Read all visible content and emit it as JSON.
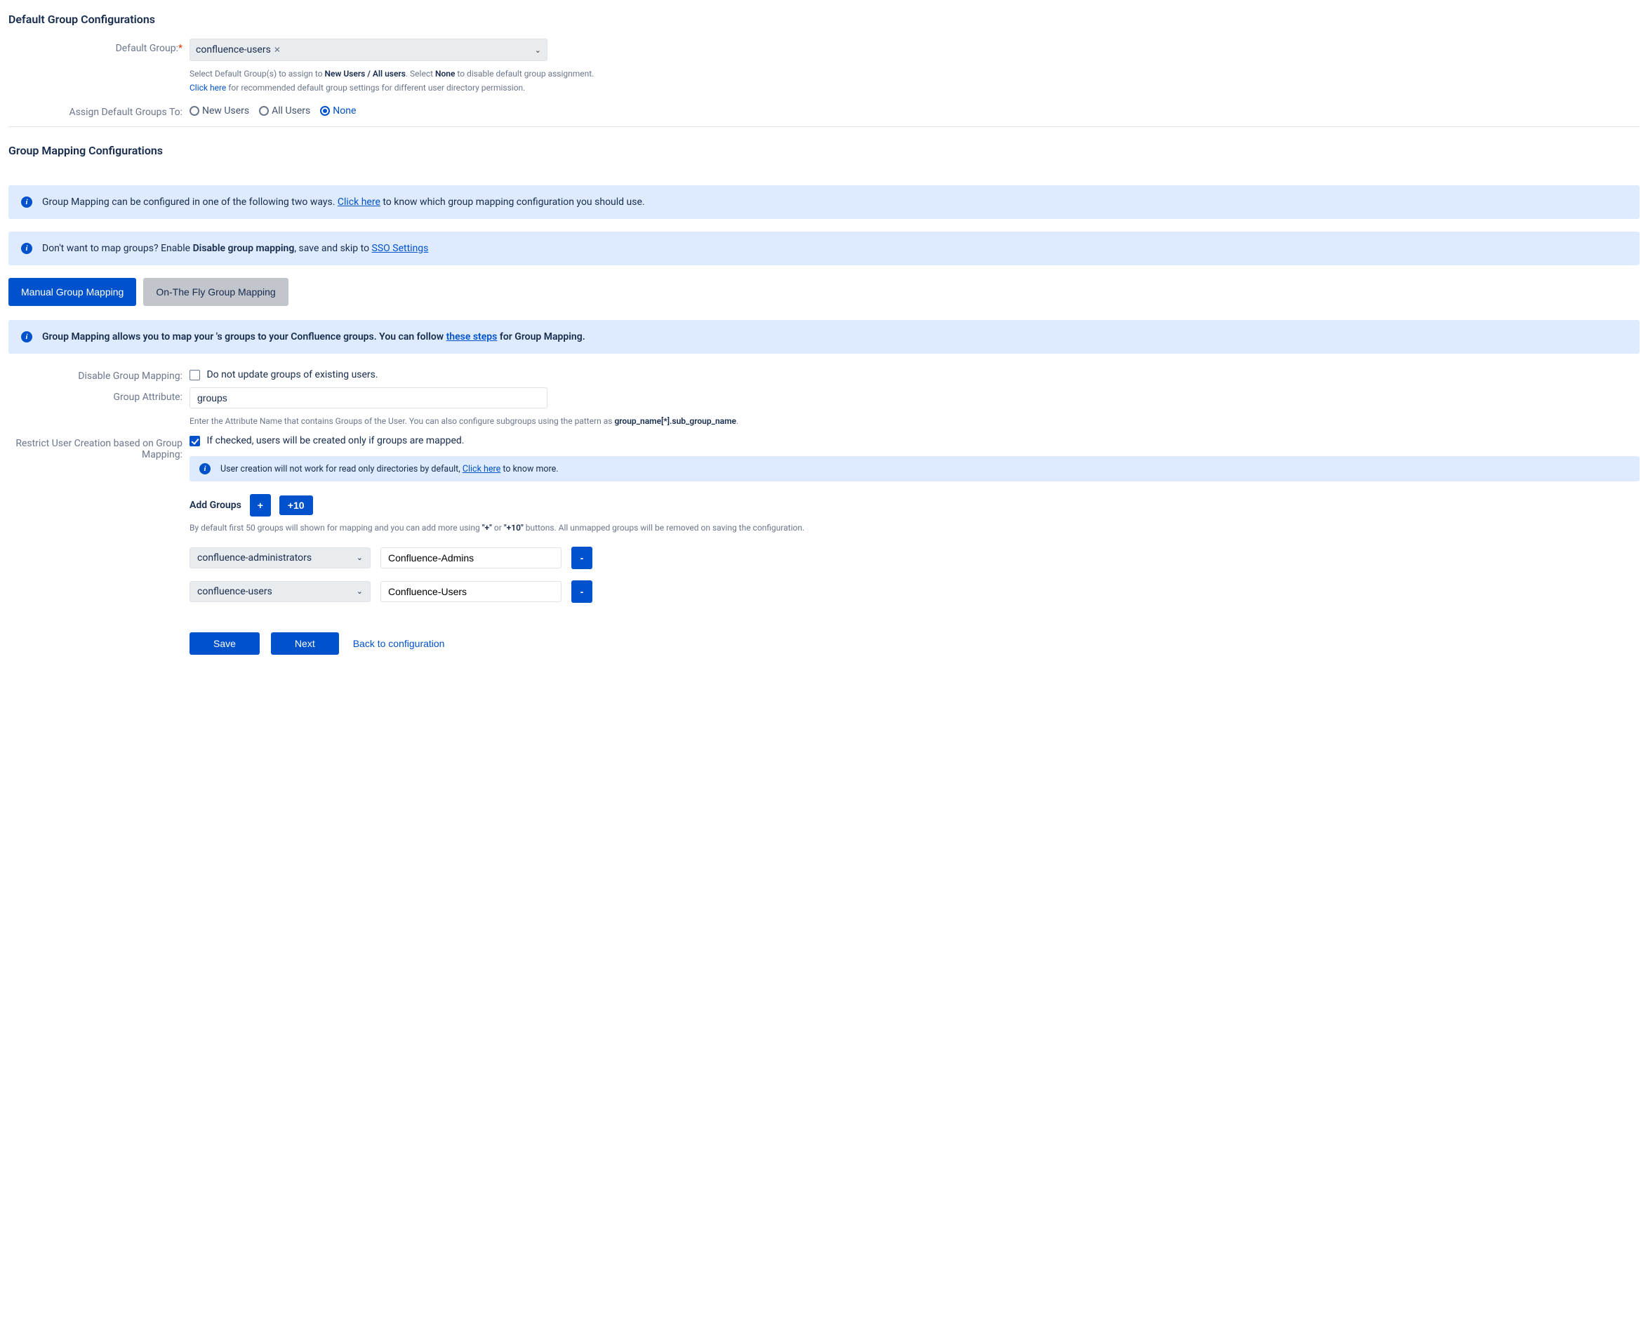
{
  "section1_title": "Default Group Configurations",
  "default_group_label": "Default Group:",
  "default_group_value": "confluence-users",
  "default_group_help_pre": "Select Default Group(s) to assign to ",
  "default_group_help_b1": "New Users / All users",
  "default_group_help_mid": ". Select ",
  "default_group_help_b2": "None",
  "default_group_help_post": " to disable default group assignment.",
  "default_group_link": "Click here",
  "default_group_link_after": " for recommended default group settings for different user directory permission.",
  "assign_label": "Assign Default Groups To:",
  "radio_new": "New Users",
  "radio_all": "All Users",
  "radio_none": "None",
  "section2_title": "Group Mapping Configurations",
  "banner1_pre": "Group Mapping can be configured in one of the following two ways. ",
  "banner1_link": "Click here",
  "banner1_post": " to know which group mapping configuration you should use.",
  "banner2_pre": "Don't want to map groups? Enable ",
  "banner2_b": "Disable group mapping",
  "banner2_mid": ", save and skip to ",
  "banner2_link": "SSO Settings",
  "tab1": "Manual Group Mapping",
  "tab2": "On-The Fly Group Mapping",
  "banner3_pre": "Group Mapping allows you to map your 's groups to your Confluence groups. You can follow ",
  "banner3_link": "these steps",
  "banner3_post": " for Group Mapping.",
  "disable_label": "Disable Group Mapping:",
  "disable_chk_label": "Do not update groups of existing users.",
  "attr_label": "Group Attribute:",
  "attr_value": "groups",
  "attr_help_pre": "Enter the Attribute Name that contains Groups of the User. You can also configure subgroups using the pattern as ",
  "attr_help_b": "group_name[*].sub_group_name",
  "restrict_label": "Restrict User Creation based on Group Mapping:",
  "restrict_chk_label": "If checked, users will be created only if groups are mapped.",
  "restrict_banner_pre": "User creation will not work for read only directories by default, ",
  "restrict_banner_link": "Click here",
  "restrict_banner_post": " to know more.",
  "add_groups_label": "Add Groups",
  "plus_btn": "+",
  "plus10_btn": "+10",
  "add_help_pre": "By default first 50 groups will shown for mapping and you can add more using ",
  "add_help_b1": "\"+\"",
  "add_help_mid": " or ",
  "add_help_b2": "\"+10\"",
  "add_help_post": " buttons. All unmapped groups will be removed on saving the configuration.",
  "mappings": [
    {
      "group": "confluence-administrators",
      "target": "Confluence-Admins"
    },
    {
      "group": "confluence-users",
      "target": "Confluence-Users"
    }
  ],
  "minus_btn": "-",
  "save_btn": "Save",
  "next_btn": "Next",
  "back_link": "Back to configuration"
}
